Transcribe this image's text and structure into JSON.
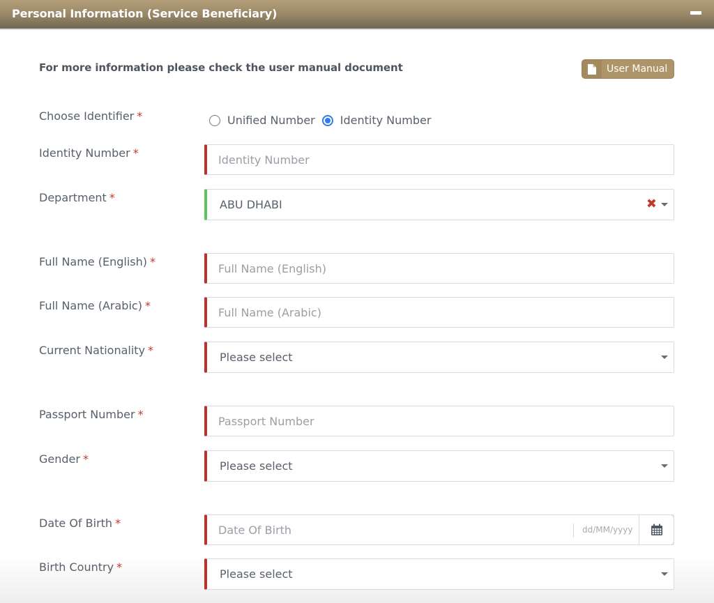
{
  "header": {
    "title": "Personal Information (Service Beneficiary)",
    "collapse_icon": "minus-icon"
  },
  "info": {
    "text": "For more information please check the user manual document",
    "manual_button_label": "User Manual",
    "manual_icon": "file-icon"
  },
  "required_marker": "*",
  "identifier": {
    "label": "Choose Identifier",
    "options": [
      {
        "label": "Unified Number",
        "checked": false
      },
      {
        "label": "Identity Number",
        "checked": true
      }
    ]
  },
  "fields": {
    "identity_number": {
      "label": "Identity Number",
      "placeholder": "Identity Number",
      "value": ""
    },
    "department": {
      "label": "Department",
      "value": "ABU DHABI"
    },
    "full_name_en": {
      "label": "Full Name (English)",
      "placeholder": "Full Name (English)",
      "value": ""
    },
    "full_name_ar": {
      "label": "Full Name (Arabic)",
      "placeholder": "Full Name (Arabic)",
      "value": ""
    },
    "nationality": {
      "label": "Current Nationality",
      "value": "Please select"
    },
    "passport": {
      "label": "Passport Number",
      "placeholder": "Passport Number",
      "value": ""
    },
    "gender": {
      "label": "Gender",
      "value": "Please select"
    },
    "dob": {
      "label": "Date Of Birth",
      "placeholder": "Date Of Birth",
      "format": "dd/MM/yyyy",
      "value": ""
    },
    "birth_country": {
      "label": "Birth Country",
      "value": "Please select"
    }
  },
  "colors": {
    "header": "#9a8868",
    "accent": "#ad9569",
    "required": "#c0302a",
    "valid": "#5cc45e",
    "radio": "#2f7bf0"
  }
}
